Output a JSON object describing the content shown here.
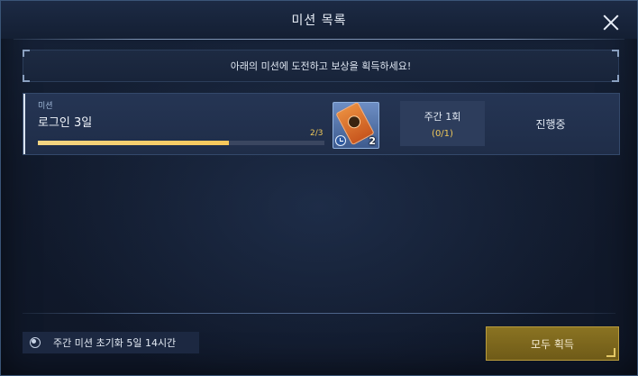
{
  "dialog": {
    "title": "미션 목록",
    "banner_text": "아래의 미션에 도전하고 보상을 획득하세요!"
  },
  "mission": {
    "label": "미션",
    "name": "로그인 3일",
    "progress_text": "2/3",
    "progress_fraction": 0.667,
    "reward": {
      "icon": "orange-ticket-clock-icon",
      "count": "2"
    },
    "limit_title": "주간 1회",
    "limit_count": "(0/1)",
    "status": "진행중"
  },
  "footer": {
    "reset_text": "주간 미션 초기화 5일 14시간",
    "claim_all_label": "모두 획득"
  },
  "colors": {
    "progress_fill": "#f7c85a",
    "claim_button": "#7d6820",
    "accent_text": "#f0c95a"
  }
}
